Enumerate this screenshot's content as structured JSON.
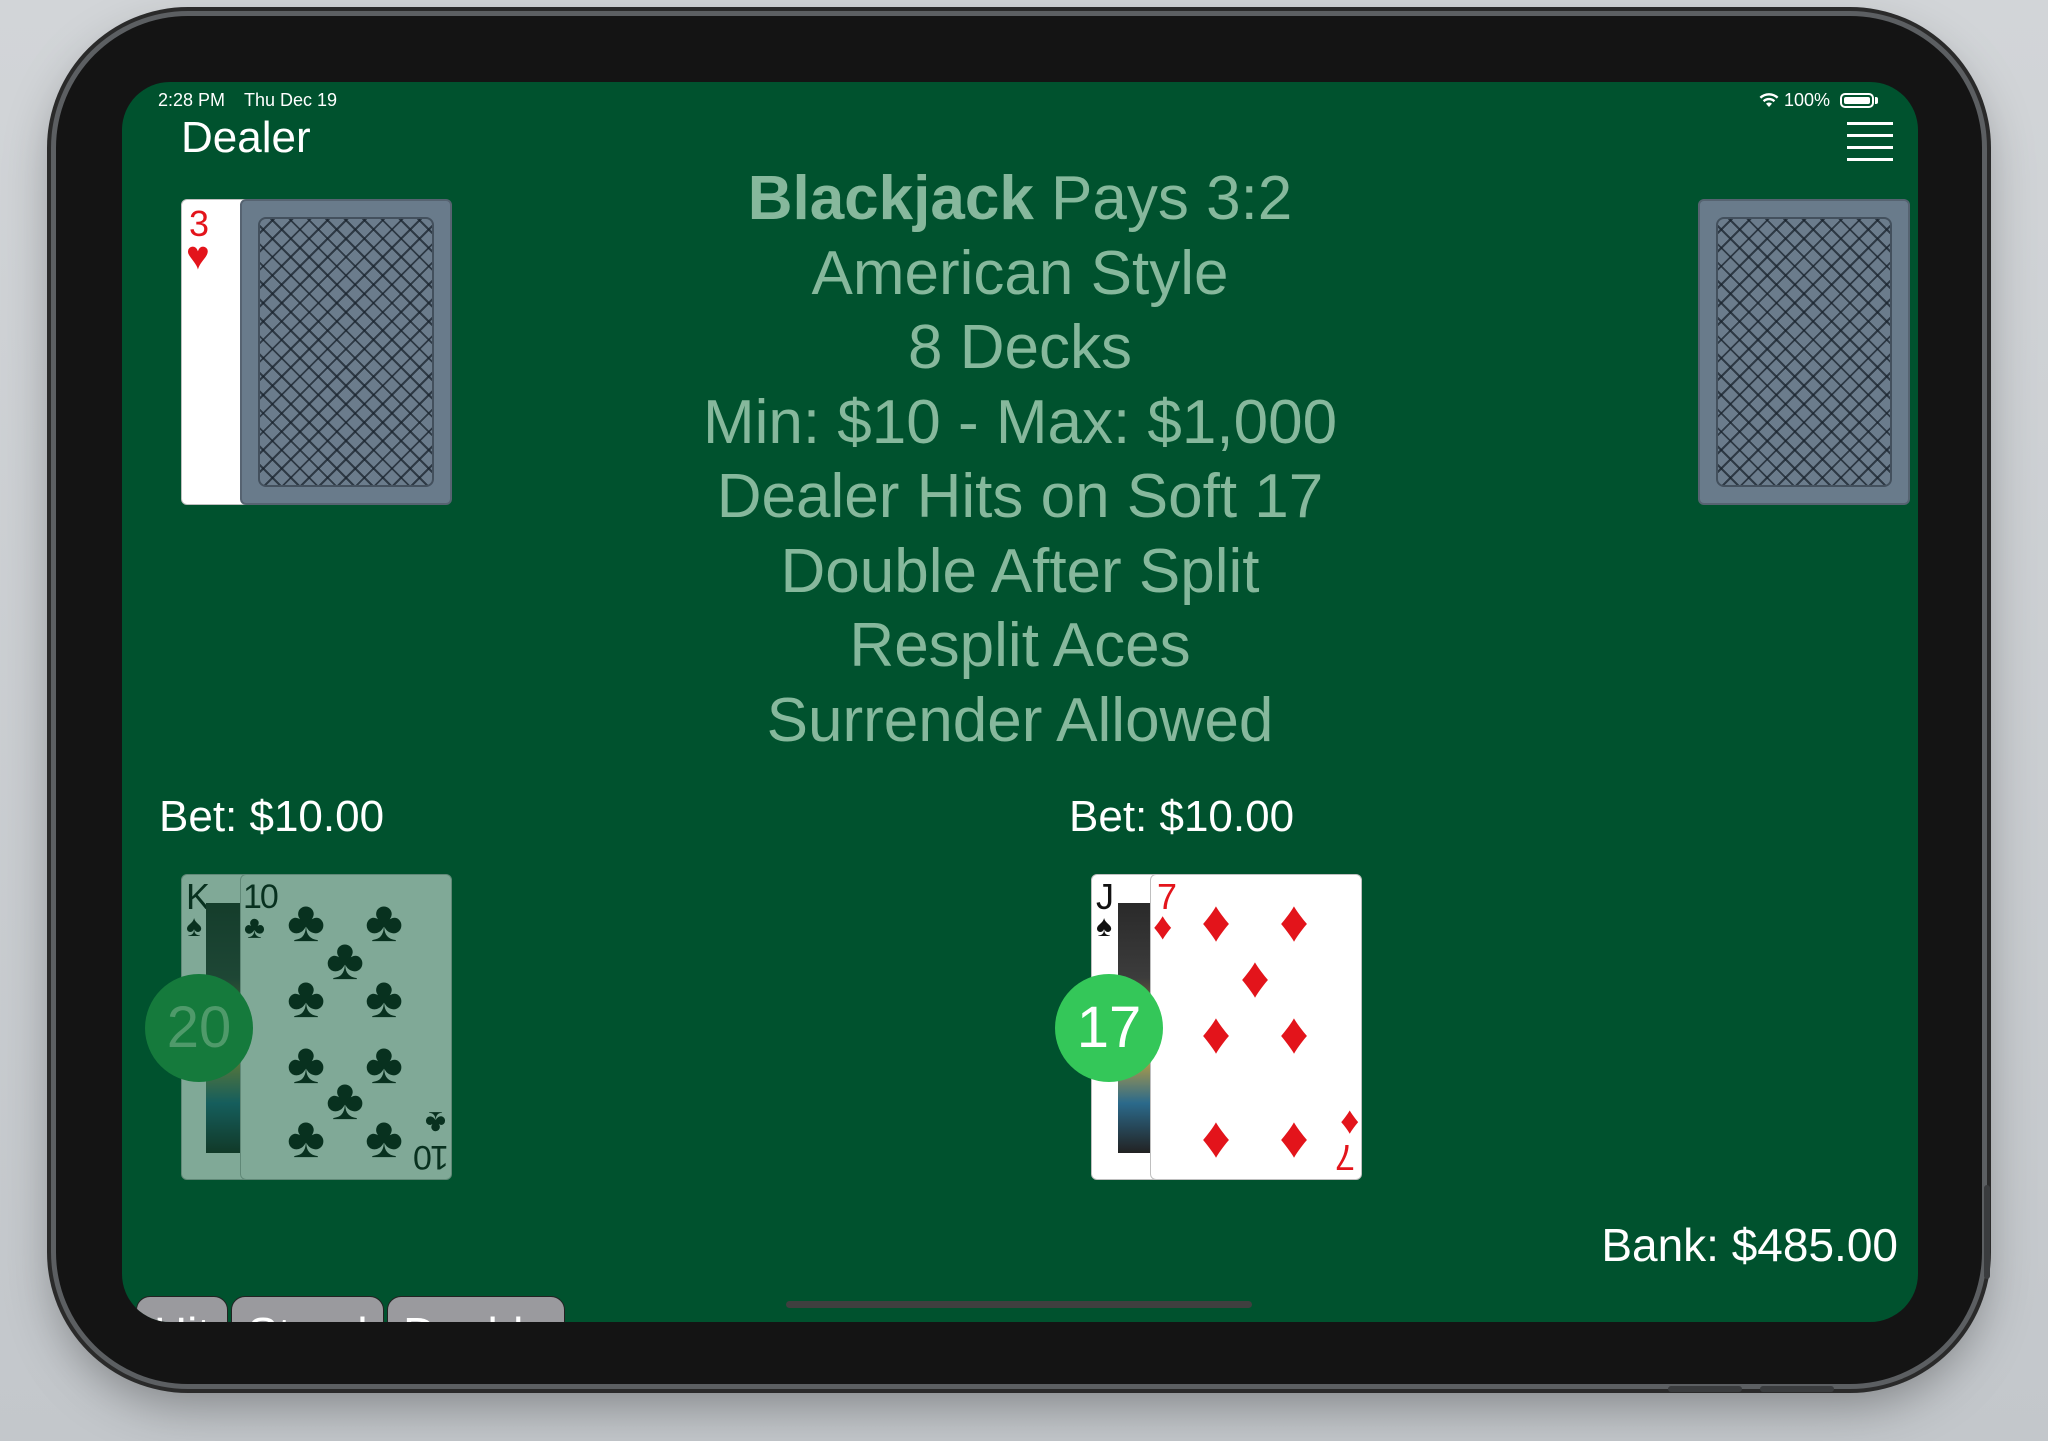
{
  "status_bar": {
    "time": "2:28 PM",
    "date": "Thu Dec 19",
    "battery": "100%"
  },
  "dealer": {
    "label": "Dealer",
    "up_card": {
      "rank": "3",
      "suit": "♥"
    }
  },
  "rules": {
    "title_bold": "Blackjack",
    "title_rest": " Pays 3:2",
    "lines": [
      "American Style",
      "8 Decks",
      "Min: $10 - Max: $1,000",
      "Dealer Hits on Soft 17",
      "Double After Split",
      "Resplit Aces",
      "Surrender Allowed"
    ]
  },
  "hands": [
    {
      "bet": "Bet: $10.00",
      "score": "20",
      "active": false,
      "cards": [
        {
          "rank": "K",
          "suit": "♠"
        },
        {
          "rank": "10",
          "suit": "♣"
        }
      ]
    },
    {
      "bet": "Bet: $10.00",
      "score": "17",
      "active": true,
      "cards": [
        {
          "rank": "J",
          "suit": "♠"
        },
        {
          "rank": "7",
          "suit": "♦"
        }
      ]
    }
  ],
  "actions": {
    "hit": "Hit",
    "stand": "Stand",
    "double": "Double"
  },
  "bank": "Bank: $485.00",
  "colors": {
    "felt": "#00522e",
    "rules_text": "#86b89c",
    "score_active": "#34c759",
    "score_inactive": "#157a3c",
    "card_back": "#697b8b",
    "button": "#9a9a9e"
  },
  "icons": {
    "menu": "hamburger-menu-icon",
    "wifi": "wifi-icon",
    "battery": "battery-icon"
  }
}
